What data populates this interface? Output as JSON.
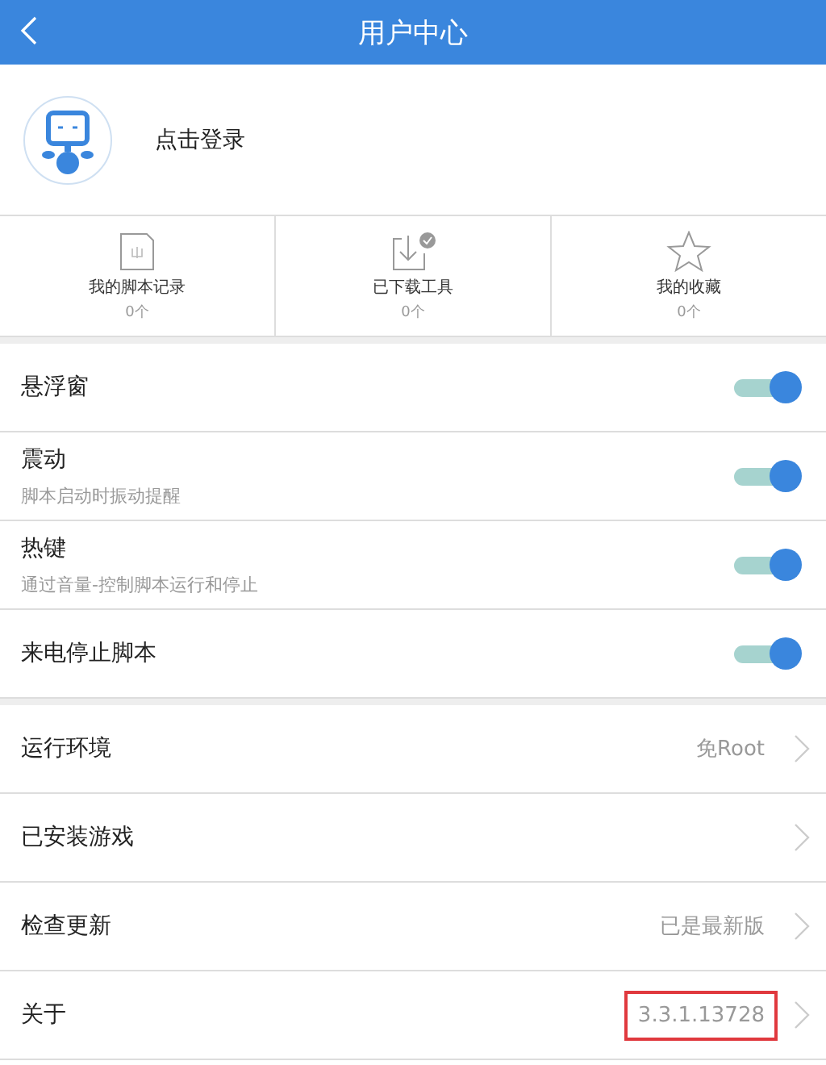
{
  "header": {
    "title": "用户中心"
  },
  "profile": {
    "login": "点击登录"
  },
  "stats": [
    {
      "kind": "scripts",
      "label": "我的脚本记录",
      "count": "0个"
    },
    {
      "kind": "downloads",
      "label": "已下载工具",
      "count": "0个"
    },
    {
      "kind": "favorites",
      "label": "我的收藏",
      "count": "0个"
    }
  ],
  "toggles": [
    {
      "label": "悬浮窗",
      "on": true
    },
    {
      "label": "震动",
      "hint": "脚本启动时振动提醒",
      "on": true
    },
    {
      "label": "热键",
      "hint": "通过音量-控制脚本运行和停止",
      "on": true
    },
    {
      "label": "来电停止脚本",
      "on": true
    }
  ],
  "nav": [
    {
      "label": "运行环境",
      "value": "免Root"
    },
    {
      "label": "已安装游戏"
    },
    {
      "label": "检查更新",
      "value": "已是最新版"
    },
    {
      "label": "关于",
      "value": "3.3.1.13728",
      "highlighted": true
    }
  ]
}
